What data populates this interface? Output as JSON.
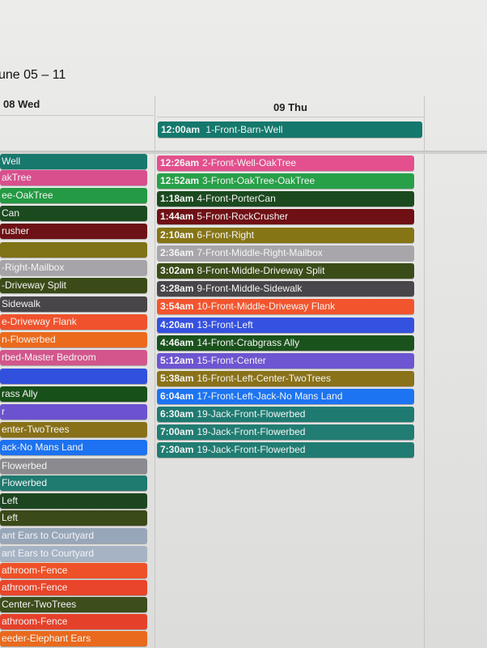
{
  "header": {
    "date_range": "une 05 – 11"
  },
  "columns": {
    "wed": "08 Wed",
    "thu": "09 Thu"
  },
  "thu_allday_event": {
    "time": "12:00am",
    "label": "1-Front-Barn-Well",
    "color": "#14786c"
  },
  "wed_events": [
    {
      "label": "Well",
      "color": "#17786d"
    },
    {
      "label": "akTree",
      "color": "#d94f8e"
    },
    {
      "label": "ee-OakTree",
      "color": "#239a43"
    },
    {
      "label": "Can",
      "color": "#1b4a1f"
    },
    {
      "label": "rusher",
      "color": "#6d1216"
    },
    {
      "label": "",
      "color": "#807216"
    },
    {
      "label": "-Right-Mailbox",
      "color": "#a7a4a9"
    },
    {
      "label": "-Driveway Split",
      "color": "#3a4b17"
    },
    {
      "label": "Sidewalk",
      "color": "#474547"
    },
    {
      "label": "e-Driveway Flank",
      "color": "#f0522d"
    },
    {
      "label": "n-Flowerbed",
      "color": "#eb6a1c"
    },
    {
      "label": "rbed-Master Bedroom",
      "color": "#d2568b"
    },
    {
      "label": "",
      "color": "#3150de"
    },
    {
      "label": "rass Ally",
      "color": "#185019"
    },
    {
      "label": "r",
      "color": "#6c52cf"
    },
    {
      "label": "enter-TwoTrees",
      "color": "#887018"
    },
    {
      "label": "ack-No Mans Land",
      "color": "#1c72f0"
    },
    {
      "label": "Flowerbed",
      "color": "#8b8a8e"
    },
    {
      "label": "Flowerbed",
      "color": "#1f7a70"
    },
    {
      "label": "Left",
      "color": "#1d4620"
    },
    {
      "label": "Left",
      "color": "#3a4a18"
    },
    {
      "label": "ant Ears to Courtyard",
      "color": "#98a6b9"
    },
    {
      "label": "ant Ears to Courtyard",
      "color": "#a6b3c4"
    },
    {
      "label": "athroom-Fence",
      "color": "#ee5128"
    },
    {
      "label": "athroom-Fence",
      "color": "#e8452a"
    },
    {
      "label": "Center-TwoTrees",
      "color": "#3d4d1b"
    },
    {
      "label": "athroom-Fence",
      "color": "#e5412a"
    },
    {
      "label": "eeder-Elephant Ears",
      "color": "#e9691d"
    }
  ],
  "thu_events": [
    {
      "time": "12:26am",
      "label": "2-Front-Well-OakTree",
      "color": "#e3508d"
    },
    {
      "time": "12:52am",
      "label": "3-Front-OakTree-OakTree",
      "color": "#27a048"
    },
    {
      "time": "1:18am",
      "label": "4-Front-PorterCan",
      "color": "#1b4a1f"
    },
    {
      "time": "1:44am",
      "label": "5-Front-RockCrusher",
      "color": "#6f1015"
    },
    {
      "time": "2:10am",
      "label": "6-Front-Right",
      "color": "#867515"
    },
    {
      "time": "2:36am",
      "label": "7-Front-Middle-Right-Mailbox",
      "color": "#a8a6ab"
    },
    {
      "time": "3:02am",
      "label": "8-Front-Middle-Driveway Split",
      "color": "#3a4c18"
    },
    {
      "time": "3:28am",
      "label": "9-Front-Middle-Sidewalk",
      "color": "#48464a"
    },
    {
      "time": "3:54am",
      "label": "10-Front-Middle-Driveway Flank",
      "color": "#f2552e"
    },
    {
      "time": "4:20am",
      "label": "13-Front-Left",
      "color": "#3551e0"
    },
    {
      "time": "4:46am",
      "label": "14-Front-Crabgrass Ally",
      "color": "#1a521c"
    },
    {
      "time": "5:12am",
      "label": "15-Front-Center",
      "color": "#6e55d1"
    },
    {
      "time": "5:38am",
      "label": "16-Front-Left-Center-TwoTrees",
      "color": "#8a7219"
    },
    {
      "time": "6:04am",
      "label": "17-Front-Left-Jack-No Mans Land",
      "color": "#1d74f2"
    },
    {
      "time": "6:30am",
      "label": "19-Jack-Front-Flowerbed",
      "color": "#1f7b72"
    },
    {
      "time": "7:00am",
      "label": "19-Jack-Front-Flowerbed",
      "color": "#217d73"
    },
    {
      "time": "7:30am",
      "label": "19-Jack-Front-Flowerbed",
      "color": "#207c72"
    }
  ]
}
